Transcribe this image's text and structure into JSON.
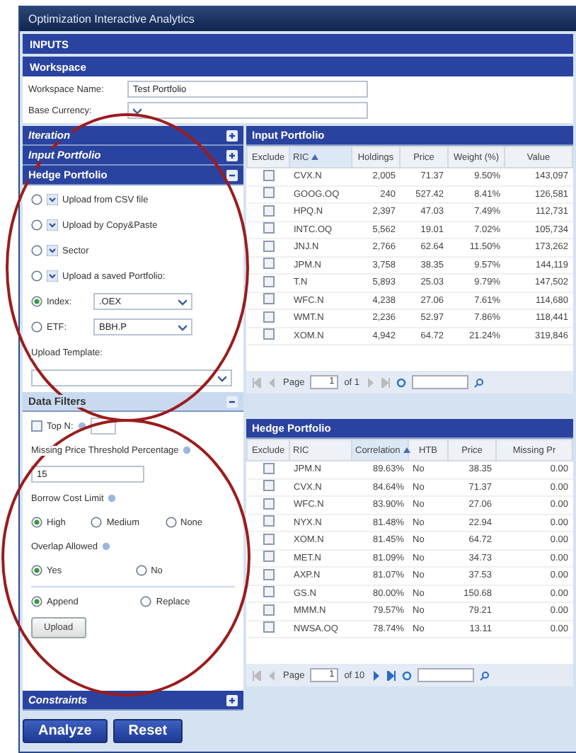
{
  "window": {
    "title": "Optimization Interactive Analytics"
  },
  "inputs_bar": {
    "title": "INPUTS"
  },
  "workspace": {
    "title": "Workspace",
    "fields": [
      {
        "label": "Workspace Name:",
        "kind": "text",
        "value": "Test Portfolio"
      },
      {
        "label": "Base Currency:",
        "kind": "select"
      }
    ]
  },
  "sections": [
    {
      "title": "Iteration",
      "expanded": false
    },
    {
      "title": "Input Portfolio",
      "expanded": false
    },
    {
      "title": "Hedge Portfolio",
      "expanded": true
    }
  ],
  "hedge_options": [
    {
      "kind": "upload",
      "label": "Upload from CSV file",
      "selected": false
    },
    {
      "kind": "upload",
      "label": "Upload by Copy&Paste",
      "selected": false
    },
    {
      "kind": "upload",
      "label": "Sector",
      "selected": false
    },
    {
      "kind": "upload",
      "label": "Upload a saved Portfolio:",
      "selected": false
    },
    {
      "kind": "select",
      "label": "Index:",
      "value": ".OEX",
      "selected": true
    },
    {
      "kind": "select",
      "label": "ETF:",
      "value": "BBH.P",
      "selected": false
    }
  ],
  "upload_template": {
    "label": "Upload Template:"
  },
  "data_filters": {
    "title": "Data Filters",
    "expanded": true,
    "top_n": {
      "label": "Top N:",
      "checked": false
    },
    "missing_price": {
      "label": "Missing Price Threshold Percentage",
      "value": "15"
    },
    "borrow_cost": {
      "label": "Borrow Cost Limit",
      "options": [
        {
          "label": "High",
          "selected": true
        },
        {
          "label": "Medium",
          "selected": false
        },
        {
          "label": "None",
          "selected": false
        }
      ]
    },
    "overlap": {
      "label": "Overlap Allowed",
      "options": [
        {
          "label": "Yes",
          "selected": true
        },
        {
          "label": "No",
          "selected": false
        }
      ]
    },
    "mode": [
      {
        "label": "Append",
        "selected": true
      },
      {
        "label": "Replace",
        "selected": false
      }
    ],
    "upload_button": "Upload"
  },
  "constraints": {
    "title": "Constraints",
    "expanded": false
  },
  "buttons": [
    "Analyze",
    "Reset"
  ],
  "input_portfolio": {
    "title": "Input Portfolio",
    "exclude_column": "Exclude",
    "columns": [
      {
        "label": "RIC",
        "sorted": true
      },
      {
        "label": "Holdings",
        "sorted": false
      },
      {
        "label": "Price",
        "sorted": false
      },
      {
        "label": "Weight (%)",
        "sorted": false
      },
      {
        "label": "Value",
        "sorted": false
      }
    ],
    "rows": [
      {
        "excluded": false,
        "cells": [
          "CVX.N",
          "2,005",
          "71.37",
          "9.50%",
          "143,097"
        ]
      },
      {
        "excluded": false,
        "cells": [
          "GOOG.OQ",
          "240",
          "527.42",
          "8.41%",
          "126,581"
        ]
      },
      {
        "excluded": false,
        "cells": [
          "HPQ.N",
          "2,397",
          "47.03",
          "7.49%",
          "112,731"
        ]
      },
      {
        "excluded": false,
        "cells": [
          "INTC.OQ",
          "5,562",
          "19.01",
          "7.02%",
          "105,734"
        ]
      },
      {
        "excluded": false,
        "cells": [
          "JNJ.N",
          "2,766",
          "62.64",
          "11.50%",
          "173,262"
        ]
      },
      {
        "excluded": false,
        "cells": [
          "JPM.N",
          "3,758",
          "38.35",
          "9.57%",
          "144,119"
        ]
      },
      {
        "excluded": false,
        "cells": [
          "T.N",
          "5,893",
          "25.03",
          "9.79%",
          "147,502"
        ]
      },
      {
        "excluded": false,
        "cells": [
          "WFC.N",
          "4,238",
          "27.06",
          "7.61%",
          "114,680"
        ]
      },
      {
        "excluded": false,
        "cells": [
          "WMT.N",
          "2,236",
          "52.97",
          "7.86%",
          "118,441"
        ]
      },
      {
        "excluded": false,
        "cells": [
          "XOM.N",
          "4,942",
          "64.72",
          "21.24%",
          "319,846"
        ]
      }
    ],
    "pager": {
      "label": "Page",
      "page": "1",
      "of": "of 1",
      "next_enabled": false
    }
  },
  "hedge_portfolio": {
    "title": "Hedge Portfolio",
    "exclude_column": "Exclude",
    "columns": [
      {
        "label": "RIC",
        "sorted": false
      },
      {
        "label": "Correlation",
        "sorted": true
      },
      {
        "label": "HTB",
        "sorted": false
      },
      {
        "label": "Price",
        "sorted": false
      },
      {
        "label": "Missing Pr",
        "sorted": false
      }
    ],
    "rows": [
      {
        "excluded": false,
        "cells": [
          "JPM.N",
          "89.63%",
          "No",
          "38.35",
          "0.00"
        ]
      },
      {
        "excluded": false,
        "cells": [
          "CVX.N",
          "84.64%",
          "No",
          "71.37",
          "0.00"
        ]
      },
      {
        "excluded": false,
        "cells": [
          "WFC.N",
          "83.90%",
          "No",
          "27.06",
          "0.00"
        ]
      },
      {
        "excluded": false,
        "cells": [
          "NYX.N",
          "81.48%",
          "No",
          "22.94",
          "0.00"
        ]
      },
      {
        "excluded": false,
        "cells": [
          "XOM.N",
          "81.45%",
          "No",
          "64.72",
          "0.00"
        ]
      },
      {
        "excluded": false,
        "cells": [
          "MET.N",
          "81.09%",
          "No",
          "34.73",
          "0.00"
        ]
      },
      {
        "excluded": false,
        "cells": [
          "AXP.N",
          "81.07%",
          "No",
          "37.53",
          "0.00"
        ]
      },
      {
        "excluded": false,
        "cells": [
          "GS.N",
          "80.00%",
          "No",
          "150.68",
          "0.00"
        ]
      },
      {
        "excluded": false,
        "cells": [
          "MMM.N",
          "79.57%",
          "No",
          "79.21",
          "0.00"
        ]
      },
      {
        "excluded": false,
        "cells": [
          "NWSA.OQ",
          "78.74%",
          "No",
          "13.11",
          "0.00"
        ]
      }
    ],
    "pager": {
      "label": "Page",
      "page": "1",
      "of": "of 10",
      "next_enabled": true
    }
  }
}
